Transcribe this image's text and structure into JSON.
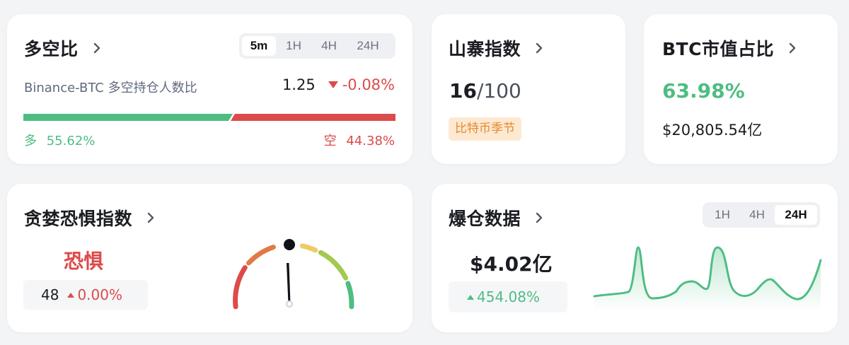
{
  "long_short": {
    "title": "多空比",
    "timeframes": [
      "5m",
      "1H",
      "4H",
      "24H"
    ],
    "active_timeframe": "5m",
    "label": "Binance-BTC 多空持仓人数比",
    "ratio": "1.25",
    "change": "-0.08%",
    "long_label": "多",
    "long_pct": "55.62%",
    "short_label": "空",
    "short_pct": "44.38%",
    "long_fraction": 0.5562
  },
  "altcoin_index": {
    "title": "山寨指数",
    "value": "16",
    "max": "/100",
    "badge": "比特币季节"
  },
  "btc_dominance": {
    "title": "BTC市值占比",
    "pct": "63.98%",
    "market_cap": "$20,805.54亿"
  },
  "fear_greed": {
    "title": "贪婪恐惧指数",
    "status": "恐惧",
    "value": "48",
    "change": "0.00%",
    "gauge_value": 48
  },
  "liquidation": {
    "title": "爆仓数据",
    "timeframes": [
      "1H",
      "4H",
      "24H"
    ],
    "active_timeframe": "24H",
    "amount": "$4.02亿",
    "change": "454.08%"
  },
  "colors": {
    "green": "#4fbd82",
    "red": "#dc4b4b",
    "badge_bg": "#fde9d2",
    "badge_text": "#e58a2a"
  }
}
